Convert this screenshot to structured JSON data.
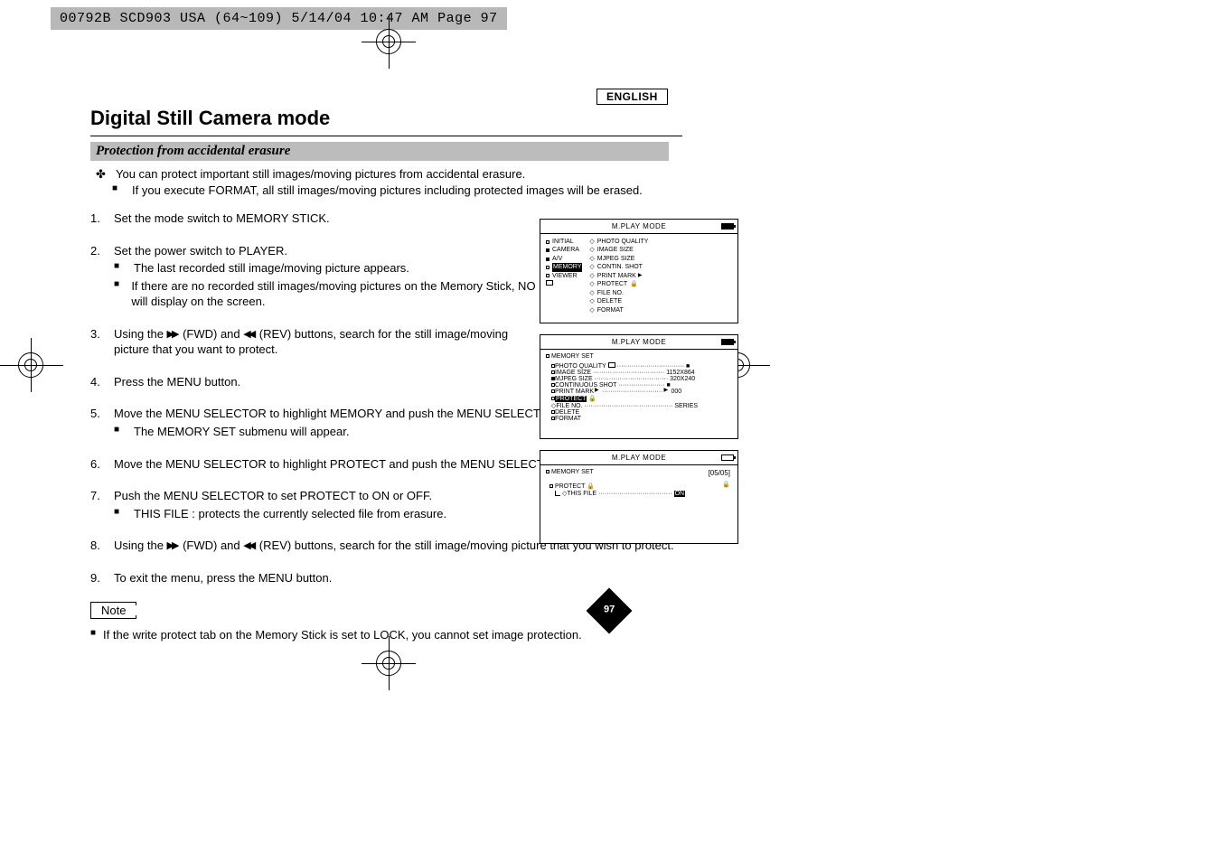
{
  "header_strip": "00792B SCD903 USA (64~109)  5/14/04 10:47 AM  Page 97",
  "language": "ENGLISH",
  "title": "Digital Still Camera mode",
  "subtitle": "Protection from accidental erasure",
  "bullets": {
    "b1": "You can protect important still images/moving pictures from accidental erasure.",
    "b2": "If you execute FORMAT, all still images/moving pictures including protected images will be erased."
  },
  "steps": {
    "s1": "Set the mode switch to MEMORY STICK.",
    "s2": "Set the power switch to PLAYER.",
    "s2a": "The last recorded still image/moving picture appears.",
    "s2b_pre": "If there are no recorded still images/moving pictures on the Memory Stick, NO STORED PHOTO! and ",
    "s2b_post": " will display on the screen.",
    "s3_pre": "Using the ",
    "s3_mid": " (FWD) and ",
    "s3_mid2": " (REV) buttons, search for the still image/moving picture that you want to protect.",
    "s4": "Press the MENU button.",
    "s5": "Move the MENU SELECTOR to highlight MEMORY and push the MENU SELECTOR.",
    "s5a": "The MEMORY SET submenu will appear.",
    "s6": "Move the MENU SELECTOR to highlight PROTECT and push the MENU SELECTOR.",
    "s7": "Push the MENU SELECTOR to set PROTECT to ON or OFF.",
    "s7a": "THIS FILE : protects the currently selected file from erasure.",
    "s8_pre": "Using the ",
    "s8_mid": " (FWD) and ",
    "s8_mid2": " (REV) buttons, search for the still image/moving picture that you wish to protect.",
    "s9": "To exit the menu, press the MENU button."
  },
  "note_label": "Note",
  "note_text": "If the write protect tab on the Memory Stick is set to LOCK, you cannot set image protection.",
  "page_number": "97",
  "screens": {
    "head": "M.PLAY  MODE",
    "s1": {
      "left": [
        "INITIAL",
        "CAMERA",
        "A/V",
        "MEMORY",
        "VIEWER"
      ],
      "right": [
        "PHOTO QUALITY",
        "IMAGE SIZE",
        "MJPEG SIZE",
        "CONTIN. SHOT",
        "PRINT MARK",
        "PROTECT",
        "FILE NO.",
        "DELETE",
        "FORMAT"
      ]
    },
    "s2": {
      "title": "MEMORY SET",
      "rows": [
        {
          "l": "PHOTO QUALITY",
          "r": ""
        },
        {
          "l": "IMAGE SIZE",
          "r": "1152X864"
        },
        {
          "l": "MJPEG SIZE",
          "r": "320X240"
        },
        {
          "l": "CONTINUOUS SHOT",
          "r": ""
        },
        {
          "l": "PRINT MARK",
          "r": "000"
        },
        {
          "l": "PROTECT",
          "r": ""
        },
        {
          "l": "FILE NO.",
          "r": "SERIES"
        },
        {
          "l": "DELETE",
          "r": ""
        },
        {
          "l": "FORMAT",
          "r": ""
        }
      ]
    },
    "s3": {
      "title": "MEMORY SET",
      "counter": "[05/05]",
      "protect": "PROTECT",
      "thisfile": "THIS FILE",
      "val": "ON"
    }
  }
}
